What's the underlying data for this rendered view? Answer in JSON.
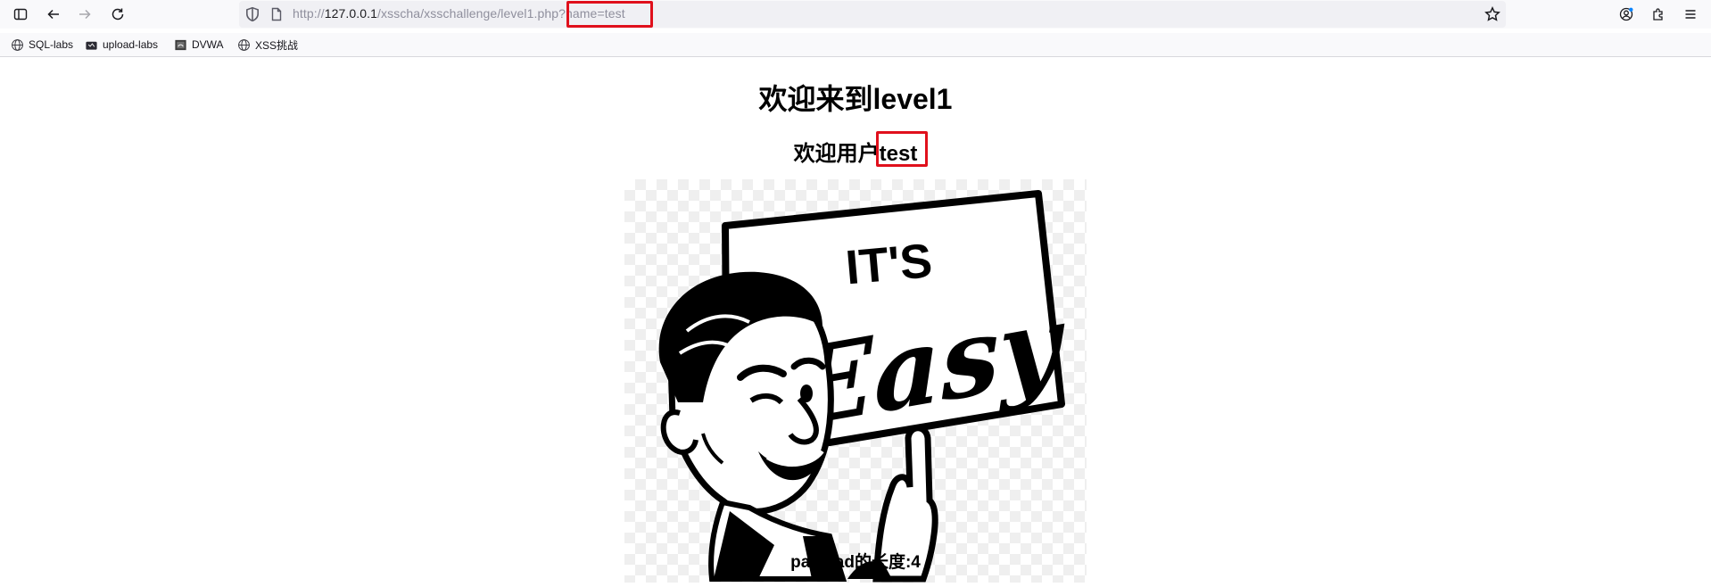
{
  "browser": {
    "url": {
      "prefix": "http://",
      "host": "127.0.0.1",
      "path": "/xsscha/xsschallenge/level1.php",
      "query": "?name=test"
    },
    "bookmarks": [
      {
        "label": "SQL-labs",
        "icon": "globe-icon"
      },
      {
        "label": "upload-labs",
        "icon": "folder-icon"
      },
      {
        "label": "DVWA",
        "icon": "dvwa-favicon"
      },
      {
        "label": "XSS挑战",
        "icon": "globe-icon"
      }
    ]
  },
  "page": {
    "heading": "欢迎来到level1",
    "welcome_prefix": "欢迎用户",
    "welcome_name": "test",
    "image_text_1": "IT'S",
    "image_text_2": "Easy",
    "payload_label": "payload的长度:",
    "payload_length": "4"
  },
  "colors": {
    "highlight": "#e0101c",
    "chrome_bg": "#f9f9fb",
    "urlbar_bg": "#f0f0f4"
  }
}
